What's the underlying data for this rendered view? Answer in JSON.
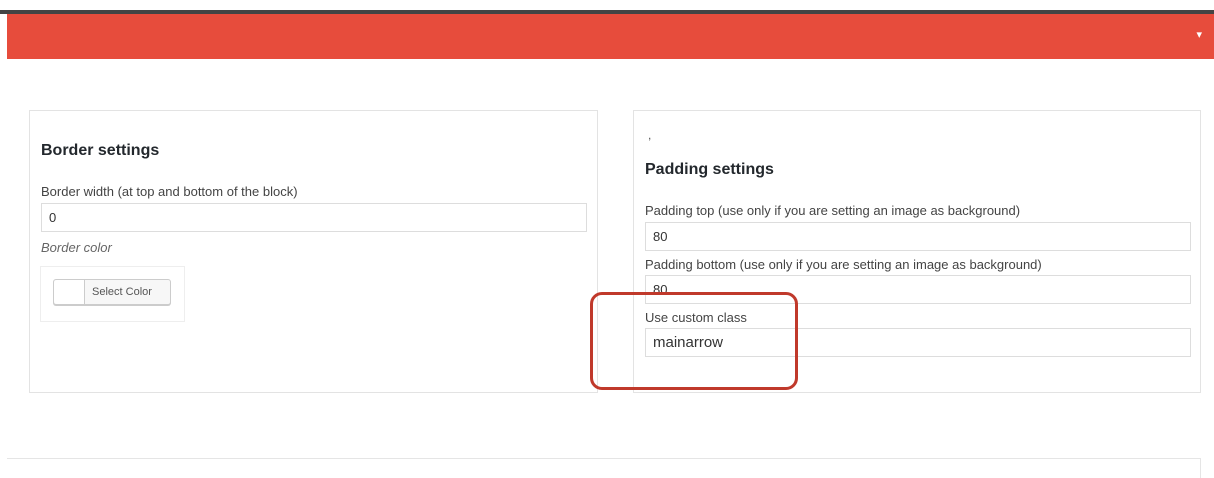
{
  "header": {
    "arrow_icon": "▾",
    "color": "#e74c3c"
  },
  "border_panel": {
    "title": "Border settings",
    "width_label": "Border width (at top and bottom of the block)",
    "width_value": "0",
    "color_label": "Border color",
    "color_button_label": "Select Color"
  },
  "padding_panel": {
    "stray_mark": ",",
    "title": "Padding settings",
    "top_label": "Padding top (use only if you are setting an image as background)",
    "top_value": "80",
    "bottom_label": "Padding bottom (use only if you are setting an image as background)",
    "bottom_value": "80",
    "custom_class_label": "Use custom class",
    "custom_class_value": "mainarrow"
  },
  "highlight_color": "#c0392b"
}
